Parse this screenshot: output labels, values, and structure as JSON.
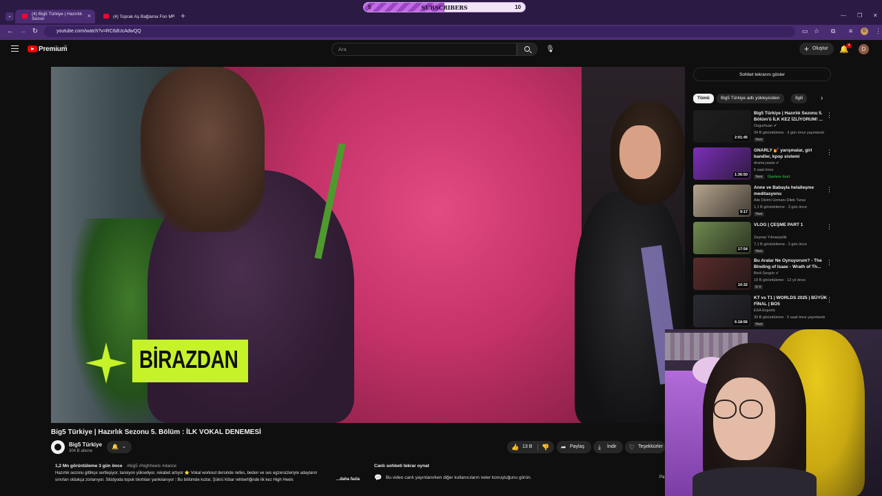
{
  "browser": {
    "tabs": [
      {
        "label": "(4) Big5 Türkiye | Hazırlık Sezon",
        "active": true
      },
      {
        "label": "(4) Toprak Aş Bağlama Fon M",
        "active": false
      }
    ],
    "url": "youtube.com/watch?v=RC6dUcAdwQQ",
    "profile_letter": "D"
  },
  "subscriber_goal": {
    "label": "SUBSCRIBERS",
    "current": "5",
    "goal": "10",
    "progress_fraction": 0.5
  },
  "header": {
    "logo_text": "Premium",
    "country_code": "TR",
    "search_placeholder": "Ara",
    "create_label": "Oluştur",
    "notification_count": "4",
    "avatar_letter": "D"
  },
  "video": {
    "overlay_text": "BİRAZDAN",
    "title": "Big5 Türkiye | Hazırlık Sezonu 5. Bölüm : İLK VOKAL DENEMESİ",
    "channel": "Big5 Türkiye",
    "subscribers": "304 B abone",
    "likes": "13 B",
    "share_label": "Paylaş",
    "download_label": "İndir",
    "thanks_label": "Teşekkürler",
    "stats": "1,2 Mn görüntüleme  3 gün önce",
    "tags": "#big5 #highheels #dance",
    "desc_line1": "Hazırlık sezonu gittikçe sertleşiyor, tansiyon yükseliyor, rekabet artıyor ⭐ Vokal workout dersinde nefes, beden ve ses egzersizleriyle adayların",
    "desc_line2": "sınırları oldukça zorlanıyor. Stüdyoda topuk tıkırtıları yankılanıyor ⁝ Bu bölümde kızlar, Şükrü Kibar rehberliğinde ilk kez High Heels",
    "more_label": "...daha fazla"
  },
  "chat_replay": {
    "title": "Canlı sohbeti tekrar oynat",
    "description": "Bu video canlı yayınlanırken diğer kullanıcıların neler konuştuğunu görün.",
    "truncated_button": "Pa"
  },
  "sidebar": {
    "chat_toggle": "Sohbet tekrarını göster",
    "chips": [
      "Tümü",
      "Big5 Türkiye adlı yükleyiciden",
      "İlgili"
    ],
    "recommendations": [
      {
        "title": "Big5 Türkiye | Hazırlık Sezonu 5. Bölüm'ü İLK KEZ İZLİYORUM! ...",
        "channel": "Ozgurhuan ✔",
        "meta": "34 B görüntüleme · 3 gün önce yayınlandı",
        "badge": "Yeni",
        "duration": "2:01:45",
        "thumb_color": "#1f1f1f"
      },
      {
        "title": "GNARLY 💅 yarışmalar, girl bandler, kpop sistemi",
        "channel": "drama pasta ✔",
        "meta": "5 saat önce",
        "badge": "Yeni",
        "member": "Üyelere özel",
        "duration": "1:36:50",
        "thumb_color": "#7b2fb8"
      },
      {
        "title": "Anne ve Babayla helalleşme meditasyonu",
        "channel": "Aile Dizimi Uzmanı Dilek Turus",
        "meta": "1,1 B görüntüleme · 3 gün önce",
        "badge": "Yeni",
        "duration": "9:17",
        "thumb_color": "#b7a58e"
      },
      {
        "title": "VLOG | ÇEŞME PART 1",
        "channel": "Zeynep Yılmazçelik",
        "meta": "7,1 B görüntüleme · 2 gün önce",
        "badge": "Yeni",
        "duration": "17:54",
        "thumb_color": "#6f8a4f"
      },
      {
        "title": "Bu Aralar Ne Oynuyorum? - The Binding of Isaac - Wrath of Th...",
        "channel": "Berli Sergün ✔",
        "meta": "19 B görüntüleme · 12 yıl önce",
        "badge": "S V",
        "duration": "10:32",
        "thumb_color": "#5a2b2b"
      },
      {
        "title": "KT vs T1 | WORLDS 2025 | BÜYÜK FİNAL | BO5",
        "channel": "ESA Esports",
        "meta": "33 B görüntüleme · 5 saat önce yayınlandı",
        "badge": "Yeni",
        "duration": "6:18:56",
        "thumb_color": "#2a2a33"
      }
    ]
  }
}
